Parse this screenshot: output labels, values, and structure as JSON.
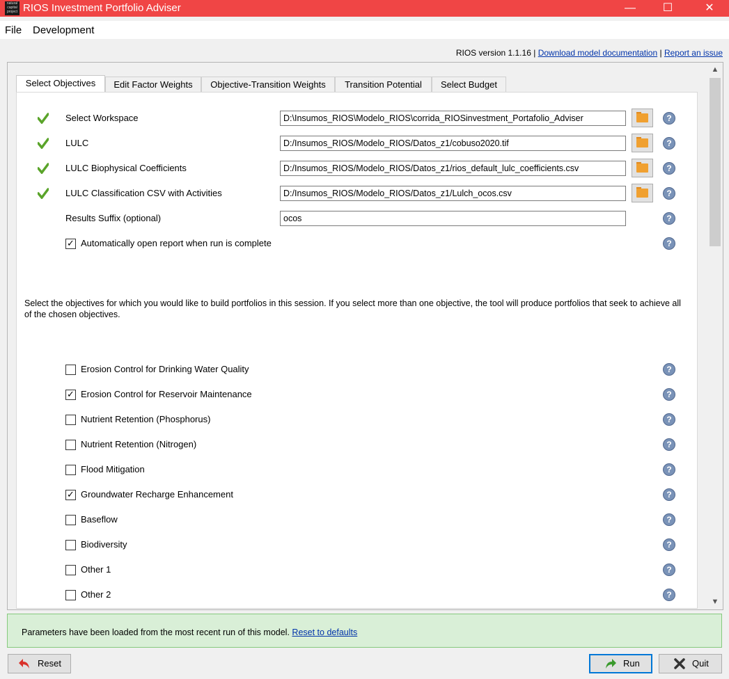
{
  "window": {
    "title": "RIOS Investment Portfolio Adviser",
    "logo_text": "natural capital project",
    "minimize": "—",
    "maximize": "☐",
    "close": "✕"
  },
  "menu": {
    "file": "File",
    "development": "Development"
  },
  "version": {
    "text": "RIOS version 1.1.16",
    "sep1": "|",
    "doc_link": "Download model documentation",
    "sep2": "|",
    "issue_link": "Report an issue"
  },
  "tabs": [
    {
      "label": "Select Objectives",
      "active": true
    },
    {
      "label": "Edit Factor Weights"
    },
    {
      "label": "Objective-Transition Weights"
    },
    {
      "label": "Transition Potential"
    },
    {
      "label": "Select Budget"
    }
  ],
  "inputs": {
    "workspace": {
      "label": "Select Workspace",
      "value": "D:\\Insumos_RIOS\\Modelo_RIOS\\corrida_RIOSinvestment_Portafolio_Adviser"
    },
    "lulc": {
      "label": "LULC",
      "value": "D:/Insumos_RIOS/Modelo_RIOS/Datos_z1/cobuso2020.tif"
    },
    "biophys": {
      "label": "LULC Biophysical Coefficients",
      "value": "D:/Insumos_RIOS/Modelo_RIOS/Datos_z1/rios_default_lulc_coefficients.csv"
    },
    "classification": {
      "label": "LULC Classification CSV with Activities",
      "value": "D:/Insumos_RIOS/Modelo_RIOS/Datos_z1/Lulch_ocos.csv"
    },
    "suffix": {
      "label": "Results Suffix (optional)",
      "value": "ocos"
    },
    "auto_open": {
      "label": "Automatically open report when run is complete",
      "checked": true
    }
  },
  "description": "Select the objectives for which you would like to build portfolios in this session. If you select more than one objective, the tool will produce portfolios that seek to achieve all of the chosen objectives.",
  "objectives": [
    {
      "label": "Erosion Control for Drinking Water Quality",
      "checked": false
    },
    {
      "label": "Erosion Control for Reservoir Maintenance",
      "checked": true
    },
    {
      "label": "Nutrient Retention (Phosphorus)",
      "checked": false
    },
    {
      "label": "Nutrient Retention (Nitrogen)",
      "checked": false
    },
    {
      "label": "Flood Mitigation",
      "checked": false
    },
    {
      "label": "Groundwater Recharge Enhancement",
      "checked": true
    },
    {
      "label": "Baseflow",
      "checked": false
    },
    {
      "label": "Biodiversity",
      "checked": false
    },
    {
      "label": "Other 1",
      "checked": false
    },
    {
      "label": "Other 2",
      "checked": false
    }
  ],
  "status": {
    "text": "Parameters have been loaded from the most recent run of this model.",
    "reset_link": "Reset to defaults"
  },
  "buttons": {
    "reset": "Reset",
    "run": "Run",
    "quit": "Quit"
  },
  "icons": {
    "help": "?",
    "check_mark": "✓",
    "scroll_up": "▲",
    "scroll_down": "▼"
  }
}
